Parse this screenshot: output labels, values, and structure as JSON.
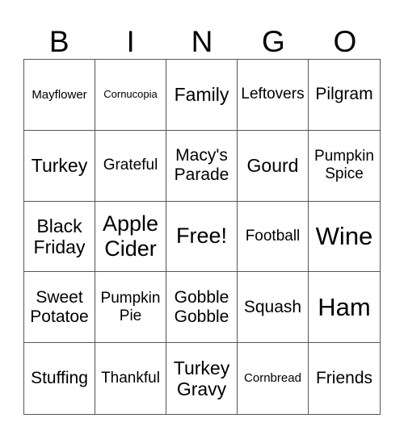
{
  "header": [
    "B",
    "I",
    "N",
    "G",
    "O"
  ],
  "cells": [
    {
      "text": "Mayflower",
      "size": "s14"
    },
    {
      "text": "Cornucopia",
      "size": "s13"
    },
    {
      "text": "Family",
      "size": "s22"
    },
    {
      "text": "Leftovers",
      "size": "s18"
    },
    {
      "text": "Pilgram",
      "size": "s20"
    },
    {
      "text": "Turkey",
      "size": "s22"
    },
    {
      "text": "Grateful",
      "size": "s18"
    },
    {
      "text": "Macy's Parade",
      "size": "s20"
    },
    {
      "text": "Gourd",
      "size": "s22"
    },
    {
      "text": "Pumpkin Spice",
      "size": "s18"
    },
    {
      "text": "Black Friday",
      "size": "s22"
    },
    {
      "text": "Apple Cider",
      "size": "s26"
    },
    {
      "text": "Free!",
      "size": "s26"
    },
    {
      "text": "Football",
      "size": "s18"
    },
    {
      "text": "Wine",
      "size": "s30"
    },
    {
      "text": "Sweet Potatoe",
      "size": "s20"
    },
    {
      "text": "Pumpkin Pie",
      "size": "s18"
    },
    {
      "text": "Gobble Gobble",
      "size": "s20"
    },
    {
      "text": "Squash",
      "size": "s20"
    },
    {
      "text": "Ham",
      "size": "s30"
    },
    {
      "text": "Stuffing",
      "size": "s20"
    },
    {
      "text": "Thankful",
      "size": "s18"
    },
    {
      "text": "Turkey Gravy",
      "size": "s22"
    },
    {
      "text": "Cornbread",
      "size": "s14"
    },
    {
      "text": "Friends",
      "size": "s20"
    }
  ]
}
